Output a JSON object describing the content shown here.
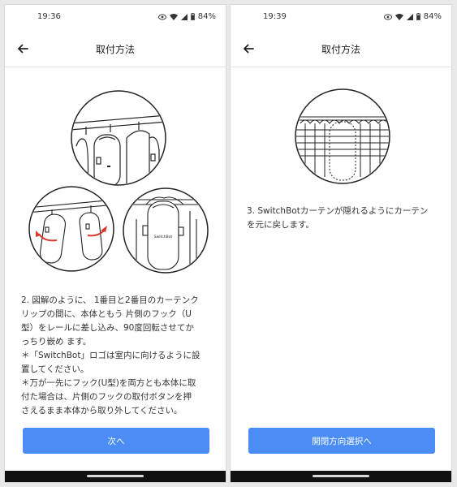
{
  "left": {
    "status": {
      "time": "19:36",
      "battery": "84%"
    },
    "title": "取付方法",
    "instruction": "2. 図解のように、 1番目と2番目のカーテンク\nリップの間に、本体ともう 片側のフック（U\n型）をレールに差し込み、90度回転させてか\nっちり嵌め ます。\n＊「SwitchBot」ロゴは室内に向けるように設\n置してください。\n＊万が一先にフック(U型)を両方とも本体に取\n付た場合は、片側のフックの取付ボタンを押\nさえるまま本体から取り外してください。",
    "button_label": "次へ",
    "device_label": "SwitchBot"
  },
  "right": {
    "status": {
      "time": "19:39",
      "battery": "84%"
    },
    "title": "取付方法",
    "instruction": "3. SwitchBotカーテンが隠れるようにカーテン\nを元に戻します。",
    "button_label": "開閉方向選択へ"
  },
  "colors": {
    "primary": "#4b8cf5",
    "accent_red": "#d9372b"
  },
  "icons": [
    "back-arrow-icon",
    "eye-icon",
    "wifi-icon",
    "signal-icon",
    "battery-icon"
  ]
}
